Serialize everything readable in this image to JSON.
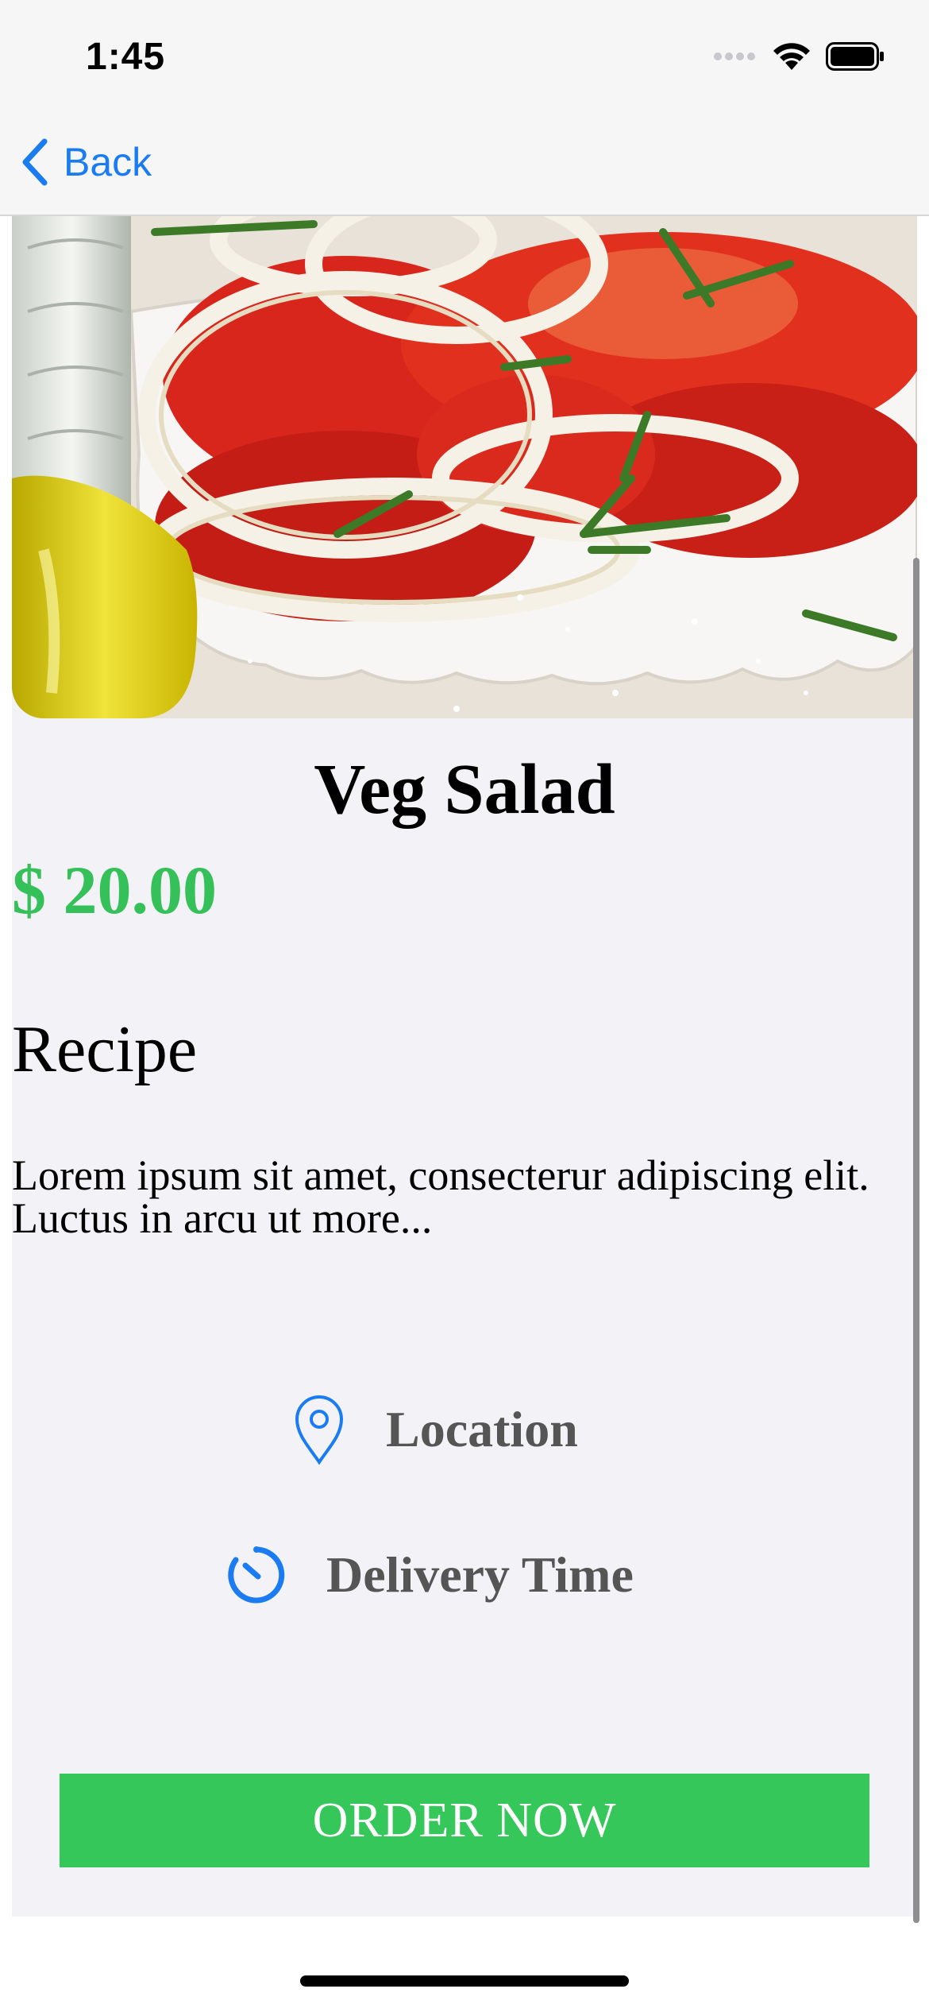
{
  "status_bar": {
    "time": "1:45",
    "icons": [
      "signal-icon",
      "wifi-icon",
      "battery-icon"
    ]
  },
  "nav": {
    "back_label": "Back",
    "back_icon": "chevron-left-icon",
    "accent_color": "#1a7cf0"
  },
  "hero_image": {
    "subject": "tomato and onion salad with olive oil bottle"
  },
  "dish": {
    "title": "Veg Salad",
    "price": "$ 20.00",
    "price_color": "#35c05a"
  },
  "recipe": {
    "heading": "Recipe",
    "text": "Lorem ipsum sit amet, consecterur adipiscing elit. Luctus in arcu ut more..."
  },
  "info": {
    "location_label": "Location",
    "location_icon": "location-pin-icon",
    "delivery_label": "Delivery Time",
    "delivery_icon": "timer-icon"
  },
  "order_button": {
    "label": "ORDER NOW",
    "color": "#35c759"
  }
}
